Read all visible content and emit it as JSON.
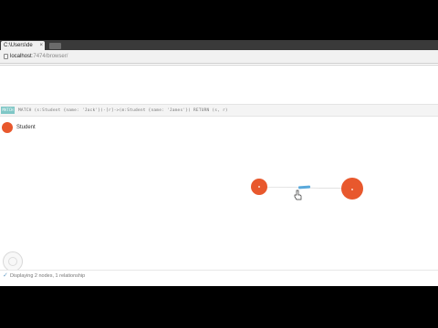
{
  "browser": {
    "tab_title": "C:\\Users\\de",
    "tab_close": "×",
    "url_host": "localhost",
    "url_path": ":7474/browser/"
  },
  "editor": {
    "run_label": "MATCH",
    "query": "MATCH (s:Student {name: 'Jack'})-[r]->(m:Student {name: 'James'}) RETURN (s, r)"
  },
  "legend": {
    "label": "Student",
    "color": "#e8582d"
  },
  "graph": {
    "node_color": "#e8582d",
    "relationship_color": "#5aa9db",
    "nodes": [
      {
        "label": "•",
        "role": "source"
      },
      {
        "label": "•",
        "role": "target"
      }
    ]
  },
  "status": {
    "icon": "✓",
    "text": "Displaying 2 nodes, 1 relationship"
  },
  "colors": {
    "background": "#ffffff",
    "letterbox": "#000000",
    "accent": "#7fc7c6"
  }
}
